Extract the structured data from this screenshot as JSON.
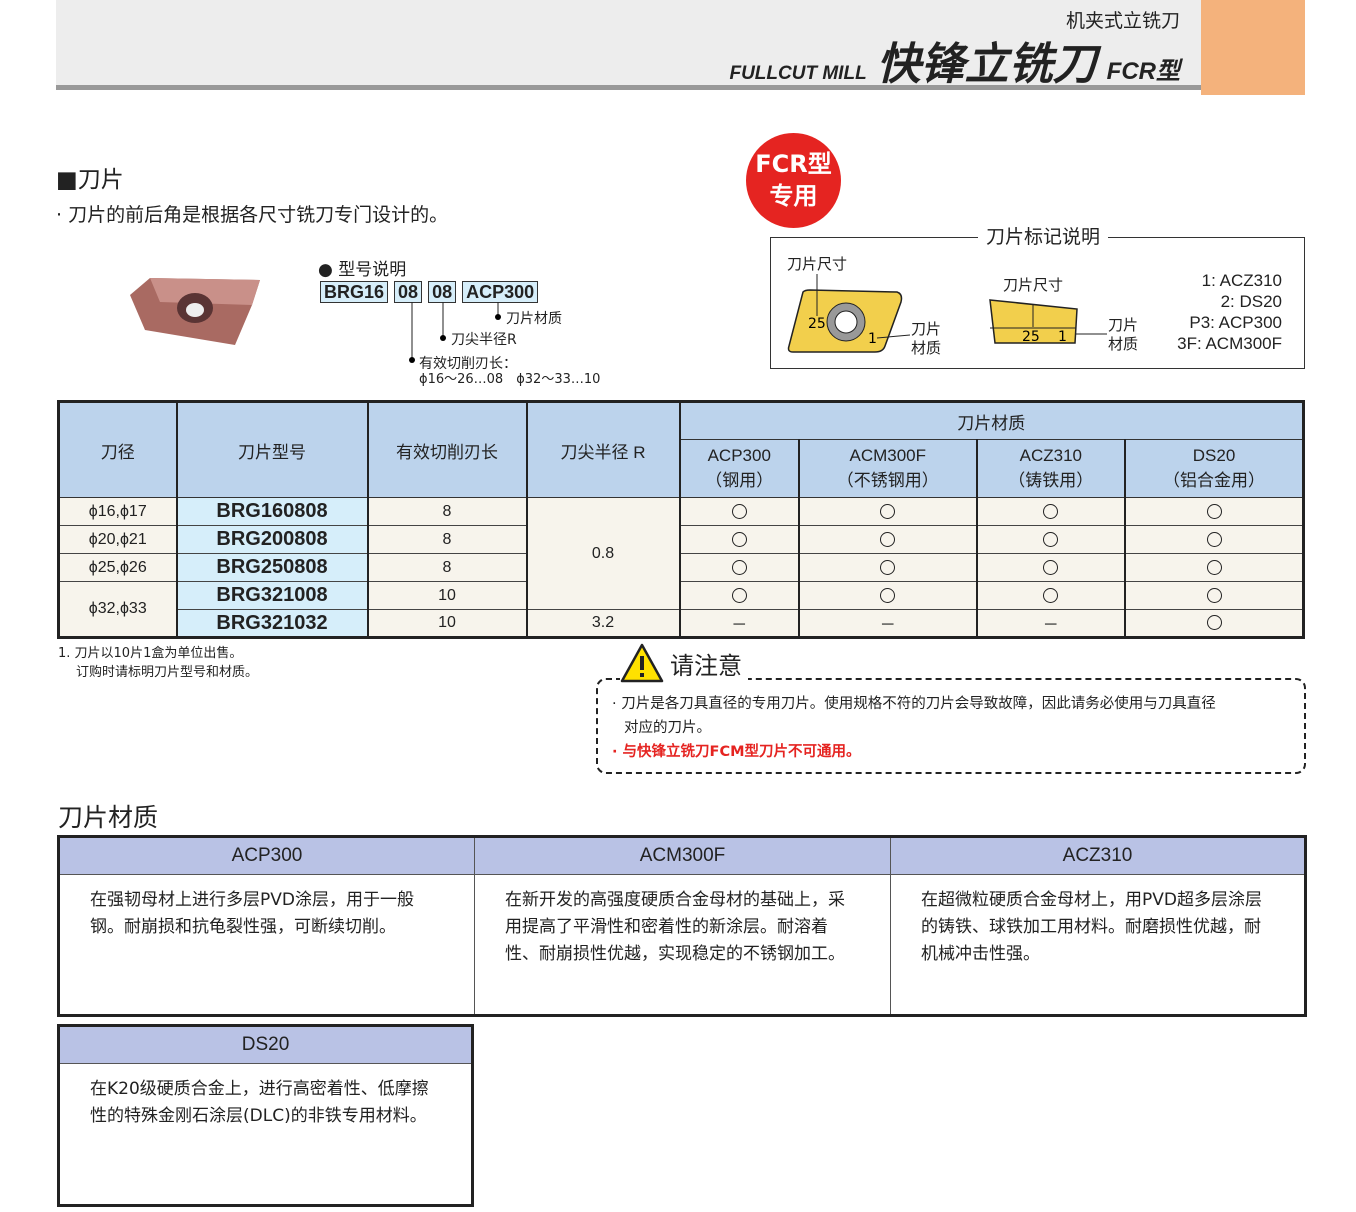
{
  "header": {
    "category": "机夹式立铣刀",
    "title_en": "FULLCUT MILL",
    "title_cn": "快锋立铣刀",
    "type": "FCR型"
  },
  "section_insert": {
    "heading": "■刀片",
    "desc": "· 刀片的前后角是根据各尺寸铣刀专门设计的。"
  },
  "badge": {
    "line1": "FCR型",
    "line2": "专用"
  },
  "model_explain": {
    "title": "● 型号说明",
    "codes": [
      "BRG16",
      "08",
      "08",
      "ACP300"
    ],
    "material": "刀片材质",
    "nose_radius": "刀尖半径R",
    "cut_length": "有效切削刃长：",
    "cut_length_values": "ϕ16〜26…08　ϕ32〜33…10"
  },
  "marking": {
    "title": "刀片标记说明",
    "size_label": "刀片尺寸",
    "material_label_1": "刀片",
    "material_label_2": "材质",
    "size_value": "25",
    "material_value": "1",
    "legend": [
      "1: ACZ310",
      "2: DS20",
      "P3: ACP300",
      "3F: ACM300F"
    ]
  },
  "spec_table": {
    "headers": {
      "diameter": "刀径",
      "model": "刀片型号",
      "cut_length": "有效切削刃长",
      "nose_radius": "刀尖半径 R",
      "material": "刀片材质"
    },
    "grades": [
      {
        "name": "ACP300",
        "use": "（钢用）"
      },
      {
        "name": "ACM300F",
        "use": "（不锈钢用）"
      },
      {
        "name": "ACZ310",
        "use": "（铸铁用）"
      },
      {
        "name": "DS20",
        "use": "（铝合金用）"
      }
    ],
    "rows": [
      {
        "diameter": "ϕ16,ϕ17",
        "model": "BRG160808",
        "cut_length": "8",
        "grades": [
          "○",
          "○",
          "○",
          "○"
        ]
      },
      {
        "diameter": "ϕ20,ϕ21",
        "model": "BRG200808",
        "cut_length": "8",
        "grades": [
          "○",
          "○",
          "○",
          "○"
        ]
      },
      {
        "diameter": "ϕ25,ϕ26",
        "model": "BRG250808",
        "cut_length": "8",
        "grades": [
          "○",
          "○",
          "○",
          "○"
        ]
      },
      {
        "diameter": "ϕ32,ϕ33",
        "model": "BRG321008",
        "cut_length": "10",
        "grades": [
          "○",
          "○",
          "○",
          "○"
        ]
      },
      {
        "diameter": "",
        "model": "BRG321032",
        "cut_length": "10",
        "grades": [
          "－",
          "－",
          "－",
          "○"
        ]
      }
    ],
    "radius_a": "0.8",
    "radius_b": "3.2"
  },
  "footnote": {
    "line1": "1. 刀片以10片1盒为单位出售。",
    "line2": "订购时请标明刀片型号和材质。"
  },
  "caution": {
    "title": "请注意",
    "line1": "· 刀片是各刀具直径的专用刀片。使用规格不符的刀片会导致故障，因此请务必使用与刀具直径",
    "line1b": "对应的刀片。",
    "line2": "· 与快锋立铣刀FCM型刀片不可通用。",
    "warn_color": "#e52421"
  },
  "materials": {
    "heading": "刀片材质",
    "items": [
      {
        "name": "ACP300",
        "desc": "在强韧母材上进行多层PVD涂层，用于一般钢。耐崩损和抗龟裂性强，可断续切削。"
      },
      {
        "name": "ACM300F",
        "desc": "在新开发的高强度硬质合金母材的基础上，采用提高了平滑性和密着性的新涂层。耐溶着性、耐崩损性优越，实现稳定的不锈钢加工。"
      },
      {
        "name": "ACZ310",
        "desc": "在超微粒硬质合金母材上，用PVD超多层涂层的铸铁、球铁加工用材料。耐磨损性优越，耐机械冲击性强。"
      },
      {
        "name": "DS20",
        "desc": "在K20级硬质合金上，进行高密着性、低摩擦性的特殊金刚石涂层(DLC)的非铁专用材料。"
      }
    ]
  }
}
